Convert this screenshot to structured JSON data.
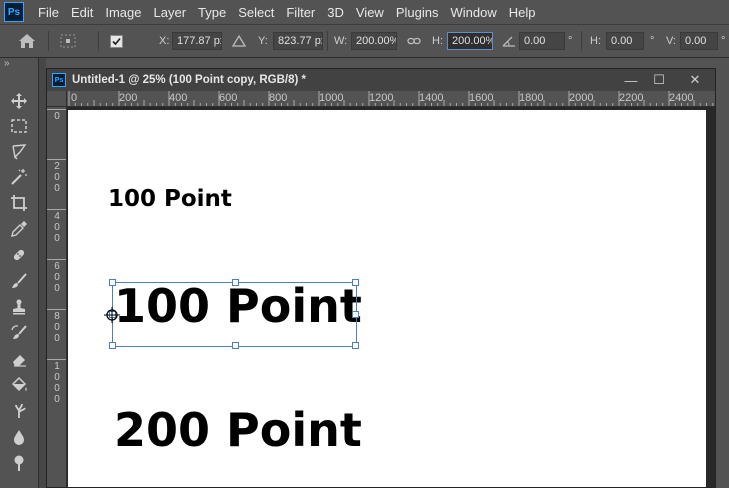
{
  "app": {
    "logo_text": "Ps"
  },
  "menu": [
    "File",
    "Edit",
    "Image",
    "Layer",
    "Type",
    "Select",
    "Filter",
    "3D",
    "View",
    "Plugins",
    "Window",
    "Help"
  ],
  "options": {
    "x_label": "X:",
    "x_value": "177.87 px",
    "y_label": "Y:",
    "y_value": "823.77 px",
    "w_label": "W:",
    "w_value": "200.00%",
    "h_label": "H:",
    "h_value": "200.00%",
    "angle_value": "0.00",
    "angle_unit": "°",
    "hskew_label": "H:",
    "hskew_value": "0.00",
    "hskew_unit": "°",
    "vskew_label": "V:",
    "vskew_value": "0.00",
    "vskew_unit": "°"
  },
  "tools": {
    "collapse_glyph": "»",
    "items": [
      "move",
      "marquee",
      "lasso",
      "magic-wand",
      "crop",
      "eyedropper",
      "healing-brush",
      "brush",
      "clone-stamp",
      "history-brush",
      "eraser",
      "paint-bucket",
      "smudge",
      "blur",
      "dodge"
    ]
  },
  "document": {
    "icon_text": "Ps",
    "title": "Untitled-1 @ 25% (100 Point copy, RGB/8) *",
    "minimize_glyph": "—",
    "maximize_glyph": "☐",
    "close_glyph": "✕",
    "h_ruler": [
      "0",
      "200",
      "400",
      "600",
      "800",
      "1000",
      "1200",
      "1400",
      "1600",
      "1800",
      "2000",
      "2200",
      "2400"
    ],
    "v_ruler": [
      [
        "0"
      ],
      [
        "2",
        "0",
        "0"
      ],
      [
        "4",
        "0",
        "0"
      ],
      [
        "6",
        "0",
        "0"
      ],
      [
        "8",
        "0",
        "0"
      ],
      [
        "1",
        "0",
        "0",
        "0"
      ]
    ],
    "texts": {
      "small": "100 Point",
      "selected": "100 Point",
      "large": "200 Point"
    }
  },
  "colors": {
    "selection": "#4a7fc1",
    "canvas": "#ffffff",
    "workspace": "#282828"
  }
}
